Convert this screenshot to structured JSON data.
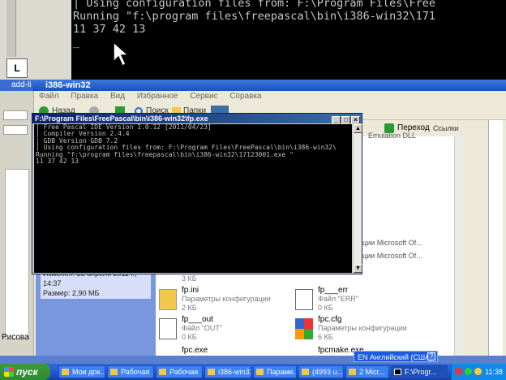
{
  "big_console": {
    "lines": [
      "| Using configuration files from: F:\\Program Files\\Free",
      "Running \"f:\\program files\\freepascal\\bin\\i386-win32\\171",
      "11 37 42 13",
      "_"
    ]
  },
  "explorer": {
    "left_title": "add-li",
    "title": "i386-win32",
    "menu": [
      "Файл",
      "Правка",
      "Вид",
      "Избранное",
      "Сервис",
      "Справка"
    ],
    "toolbar": {
      "back": "Назад",
      "search": "Поиск",
      "folders": "Папки"
    },
    "go_label": "Переход",
    "links_label": "Ссылки",
    "right_labels": [
      "Emulation DLL",
      "ации Microsoft Of...",
      "ации Microsoft Of..."
    ],
    "details": {
      "modified": "Изменен: 23 апреля 2011 г., 14:37",
      "size": "Размер: 2,90 МБ"
    },
    "left_tools": {
      "label": "Рисова"
    },
    "files": [
      {
        "name": "",
        "desc": "",
        "size": "3 КБ"
      },
      {
        "name": "fp.ini",
        "desc": "Параметры конфигурации",
        "size": "2 КБ"
      },
      {
        "name": "fp___err",
        "desc": "Файл \"ERR\"",
        "size": "0 КБ"
      },
      {
        "name": "fp___out",
        "desc": "Файл \"OUT\"",
        "size": "0 КБ"
      },
      {
        "name": "fpc.cfg",
        "desc": "Параметры конфигурации",
        "size": "6 КБ"
      },
      {
        "name": "fpc.exe",
        "desc": "",
        "size": ""
      },
      {
        "name": "fpcmake.exe",
        "desc": "",
        "size": ""
      }
    ]
  },
  "fp_console": {
    "title": "F:\\Program Files\\FreePascal\\bin\\i386-win32\\fp.exe",
    "lines": [
      "| Free Pascal IDE Version 1.0.12 [2011/04/23]",
      "| Compiler Version 2.4.4",
      "| GDB Version GDB 7.2",
      "| Using configuration files from: F:\\Program Files\\FreePascal\\bin\\i386-win32\\",
      "Running \"f:\\program files\\freepascal\\bin\\i386-win32\\17123001.exe \"",
      "11 37 42 13"
    ]
  },
  "langbar": {
    "label": "EN Английский (США)",
    "help": "?"
  },
  "taskbar": {
    "start": "пуск",
    "items": [
      "Мои док...",
      "Рабочая",
      "Рабочая",
      "i386-win32",
      "Парамe...",
      "(4993 u...",
      "2 Micr...",
      "F:\\Progr..."
    ],
    "clock": "11:38"
  },
  "colors": {
    "accent": "#245edb",
    "console_bg": "#000000",
    "start_green": "#3c9a3c"
  }
}
